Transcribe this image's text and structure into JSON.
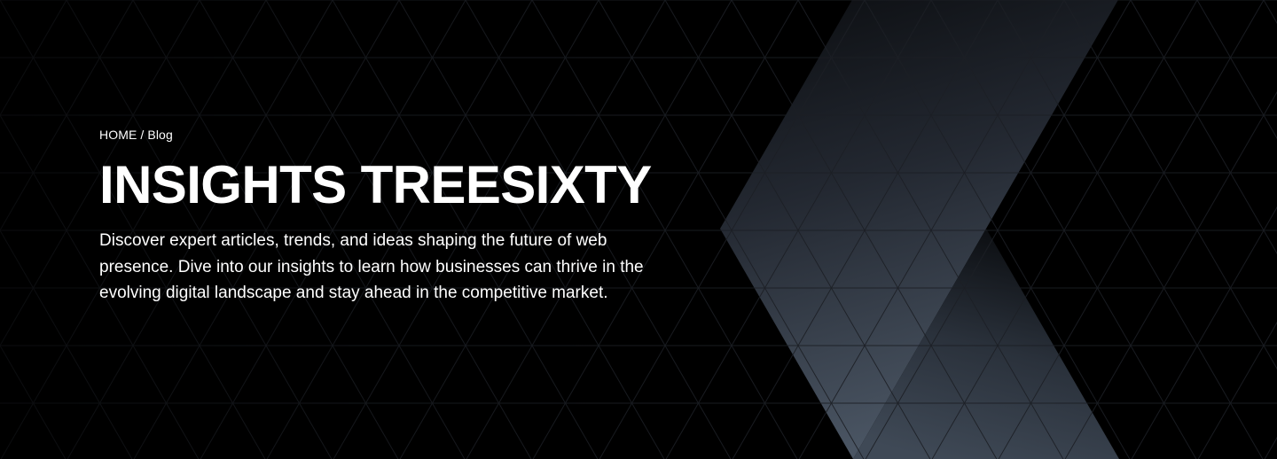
{
  "breadcrumb": {
    "home_label": "HOME",
    "separator": "/",
    "current_label": "Blog"
  },
  "hero": {
    "title": "INSIGHTS TREESIXTY",
    "description": "Discover expert articles, trends, and ideas shaping the future of web presence. Dive into our insights to learn how businesses can thrive in the evolving digital landscape and stay ahead in the competitive market."
  },
  "colors": {
    "background": "#000000",
    "text": "#ffffff",
    "grid_line": "#1a1d22",
    "shape_light": "#46505e",
    "shape_dark": "#0b0d10"
  }
}
